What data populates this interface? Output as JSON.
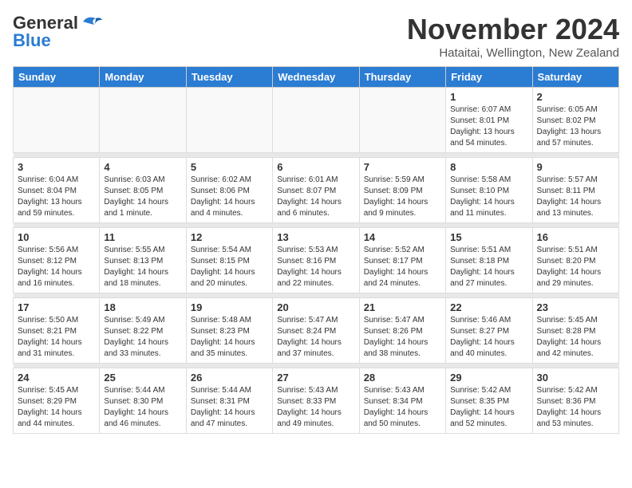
{
  "header": {
    "logo_general": "General",
    "logo_blue": "Blue",
    "month_title": "November 2024",
    "location": "Hataitai, Wellington, New Zealand"
  },
  "weekdays": [
    "Sunday",
    "Monday",
    "Tuesday",
    "Wednesday",
    "Thursday",
    "Friday",
    "Saturday"
  ],
  "weeks": [
    [
      {
        "day": "",
        "info": ""
      },
      {
        "day": "",
        "info": ""
      },
      {
        "day": "",
        "info": ""
      },
      {
        "day": "",
        "info": ""
      },
      {
        "day": "",
        "info": ""
      },
      {
        "day": "1",
        "info": "Sunrise: 6:07 AM\nSunset: 8:01 PM\nDaylight: 13 hours\nand 54 minutes."
      },
      {
        "day": "2",
        "info": "Sunrise: 6:05 AM\nSunset: 8:02 PM\nDaylight: 13 hours\nand 57 minutes."
      }
    ],
    [
      {
        "day": "3",
        "info": "Sunrise: 6:04 AM\nSunset: 8:04 PM\nDaylight: 13 hours\nand 59 minutes."
      },
      {
        "day": "4",
        "info": "Sunrise: 6:03 AM\nSunset: 8:05 PM\nDaylight: 14 hours\nand 1 minute."
      },
      {
        "day": "5",
        "info": "Sunrise: 6:02 AM\nSunset: 8:06 PM\nDaylight: 14 hours\nand 4 minutes."
      },
      {
        "day": "6",
        "info": "Sunrise: 6:01 AM\nSunset: 8:07 PM\nDaylight: 14 hours\nand 6 minutes."
      },
      {
        "day": "7",
        "info": "Sunrise: 5:59 AM\nSunset: 8:09 PM\nDaylight: 14 hours\nand 9 minutes."
      },
      {
        "day": "8",
        "info": "Sunrise: 5:58 AM\nSunset: 8:10 PM\nDaylight: 14 hours\nand 11 minutes."
      },
      {
        "day": "9",
        "info": "Sunrise: 5:57 AM\nSunset: 8:11 PM\nDaylight: 14 hours\nand 13 minutes."
      }
    ],
    [
      {
        "day": "10",
        "info": "Sunrise: 5:56 AM\nSunset: 8:12 PM\nDaylight: 14 hours\nand 16 minutes."
      },
      {
        "day": "11",
        "info": "Sunrise: 5:55 AM\nSunset: 8:13 PM\nDaylight: 14 hours\nand 18 minutes."
      },
      {
        "day": "12",
        "info": "Sunrise: 5:54 AM\nSunset: 8:15 PM\nDaylight: 14 hours\nand 20 minutes."
      },
      {
        "day": "13",
        "info": "Sunrise: 5:53 AM\nSunset: 8:16 PM\nDaylight: 14 hours\nand 22 minutes."
      },
      {
        "day": "14",
        "info": "Sunrise: 5:52 AM\nSunset: 8:17 PM\nDaylight: 14 hours\nand 24 minutes."
      },
      {
        "day": "15",
        "info": "Sunrise: 5:51 AM\nSunset: 8:18 PM\nDaylight: 14 hours\nand 27 minutes."
      },
      {
        "day": "16",
        "info": "Sunrise: 5:51 AM\nSunset: 8:20 PM\nDaylight: 14 hours\nand 29 minutes."
      }
    ],
    [
      {
        "day": "17",
        "info": "Sunrise: 5:50 AM\nSunset: 8:21 PM\nDaylight: 14 hours\nand 31 minutes."
      },
      {
        "day": "18",
        "info": "Sunrise: 5:49 AM\nSunset: 8:22 PM\nDaylight: 14 hours\nand 33 minutes."
      },
      {
        "day": "19",
        "info": "Sunrise: 5:48 AM\nSunset: 8:23 PM\nDaylight: 14 hours\nand 35 minutes."
      },
      {
        "day": "20",
        "info": "Sunrise: 5:47 AM\nSunset: 8:24 PM\nDaylight: 14 hours\nand 37 minutes."
      },
      {
        "day": "21",
        "info": "Sunrise: 5:47 AM\nSunset: 8:26 PM\nDaylight: 14 hours\nand 38 minutes."
      },
      {
        "day": "22",
        "info": "Sunrise: 5:46 AM\nSunset: 8:27 PM\nDaylight: 14 hours\nand 40 minutes."
      },
      {
        "day": "23",
        "info": "Sunrise: 5:45 AM\nSunset: 8:28 PM\nDaylight: 14 hours\nand 42 minutes."
      }
    ],
    [
      {
        "day": "24",
        "info": "Sunrise: 5:45 AM\nSunset: 8:29 PM\nDaylight: 14 hours\nand 44 minutes."
      },
      {
        "day": "25",
        "info": "Sunrise: 5:44 AM\nSunset: 8:30 PM\nDaylight: 14 hours\nand 46 minutes."
      },
      {
        "day": "26",
        "info": "Sunrise: 5:44 AM\nSunset: 8:31 PM\nDaylight: 14 hours\nand 47 minutes."
      },
      {
        "day": "27",
        "info": "Sunrise: 5:43 AM\nSunset: 8:33 PM\nDaylight: 14 hours\nand 49 minutes."
      },
      {
        "day": "28",
        "info": "Sunrise: 5:43 AM\nSunset: 8:34 PM\nDaylight: 14 hours\nand 50 minutes."
      },
      {
        "day": "29",
        "info": "Sunrise: 5:42 AM\nSunset: 8:35 PM\nDaylight: 14 hours\nand 52 minutes."
      },
      {
        "day": "30",
        "info": "Sunrise: 5:42 AM\nSunset: 8:36 PM\nDaylight: 14 hours\nand 53 minutes."
      }
    ]
  ]
}
